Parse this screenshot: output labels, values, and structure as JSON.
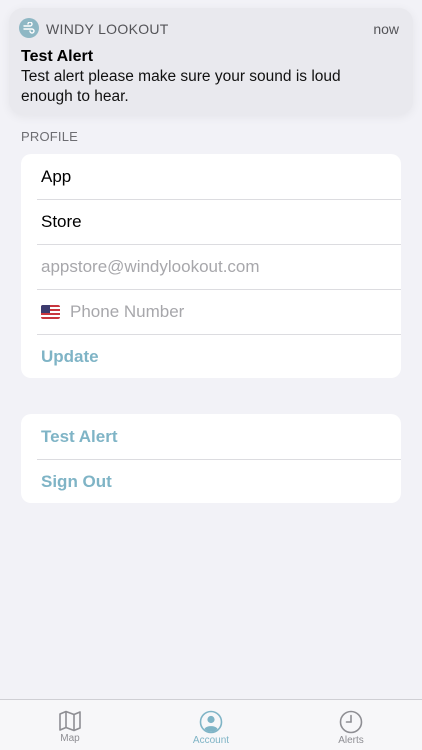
{
  "notification": {
    "app_name": "WINDY LOOKOUT",
    "time": "now",
    "title": "Test Alert",
    "body": "Test alert please make sure your sound is loud enough to hear.",
    "icon": "wind-app-icon"
  },
  "profile": {
    "section_label": "PROFILE",
    "first_name": "App",
    "last_name": "Store",
    "email_placeholder": "appstore@windylookout.com",
    "phone_placeholder": "Phone Number",
    "phone_flag": "us-flag-icon",
    "update_label": "Update"
  },
  "actions": {
    "test_alert_label": "Test Alert",
    "sign_out_label": "Sign Out"
  },
  "tabbar": {
    "items": [
      {
        "label": "Map",
        "icon": "map-icon",
        "active": false
      },
      {
        "label": "Account",
        "icon": "account-icon",
        "active": true
      },
      {
        "label": "Alerts",
        "icon": "clock-icon",
        "active": false
      }
    ]
  },
  "colors": {
    "accent": "#7fb4c6",
    "background": "#f2f2f7",
    "placeholder": "#a7a7ab"
  }
}
